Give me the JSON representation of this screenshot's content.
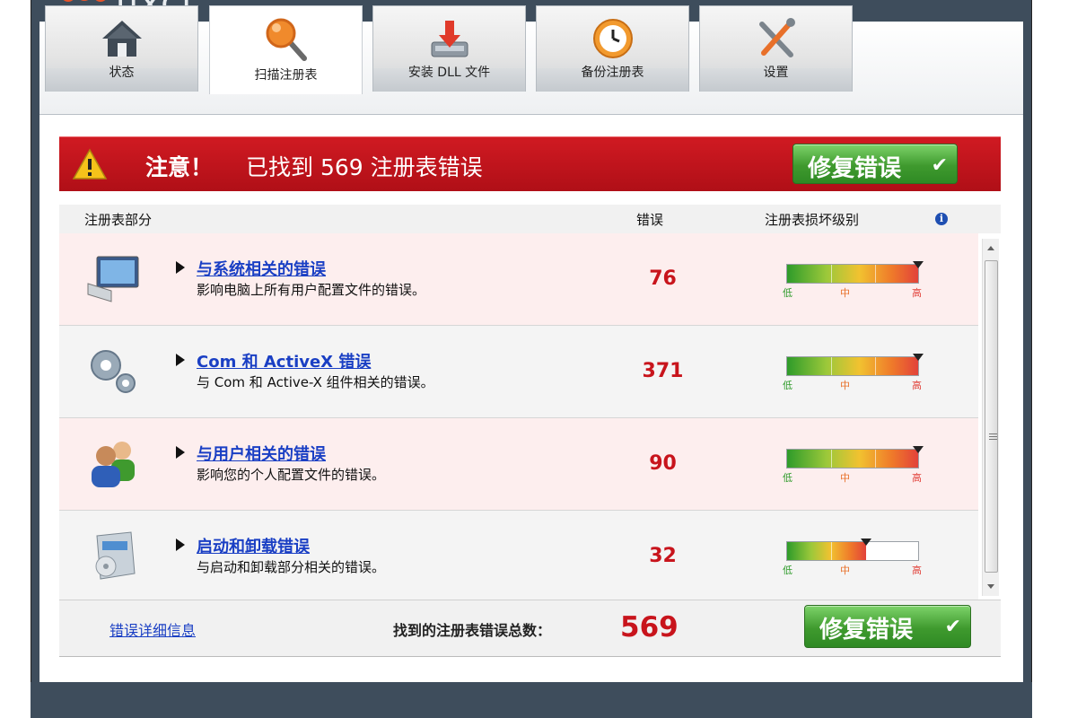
{
  "app": {
    "logo_text": "fixcl"
  },
  "tabs": [
    {
      "label": "状态",
      "icon": "home-icon"
    },
    {
      "label": "扫描注册表",
      "icon": "magnifier-icon",
      "active": true
    },
    {
      "label": "安装 DLL 文件",
      "icon": "install-tray-icon"
    },
    {
      "label": "备份注册表",
      "icon": "clock-icon"
    },
    {
      "label": "设置",
      "icon": "tools-icon"
    }
  ],
  "alert": {
    "title": "注意！",
    "message": "已找到 569 注册表错误",
    "fix_button": "修复错误",
    "colors": {
      "bar": "#c0141c",
      "button": "#3f9a2e"
    }
  },
  "table": {
    "headers": {
      "section": "注册表部分",
      "errors": "错误",
      "damage": "注册表损坏级别"
    },
    "level_labels": {
      "low": "低",
      "mid": "中",
      "high": "高"
    },
    "rows": [
      {
        "title": "与系统相关的错误",
        "desc": "影响电脑上所有用户配置文件的错误。",
        "count": "76",
        "level": 1.0,
        "icon": "monitor-icon"
      },
      {
        "title": "Com 和 ActiveX 错误",
        "desc": "与 Com 和 Active-X 组件相关的错误。",
        "count": "371",
        "level": 1.0,
        "icon": "gears-icon"
      },
      {
        "title": "与用户相关的错误",
        "desc": "影响您的个人配置文件的错误。",
        "count": "90",
        "level": 1.0,
        "icon": "users-icon"
      },
      {
        "title": "启动和卸载错误",
        "desc": "与启动和卸载部分相关的错误。",
        "count": "32",
        "level": 0.6,
        "icon": "installer-box-icon"
      }
    ]
  },
  "footer": {
    "details_link": "错误详细信息",
    "total_label": "找到的注册表错误总数：",
    "total_value": "569",
    "fix_button": "修复错误"
  }
}
